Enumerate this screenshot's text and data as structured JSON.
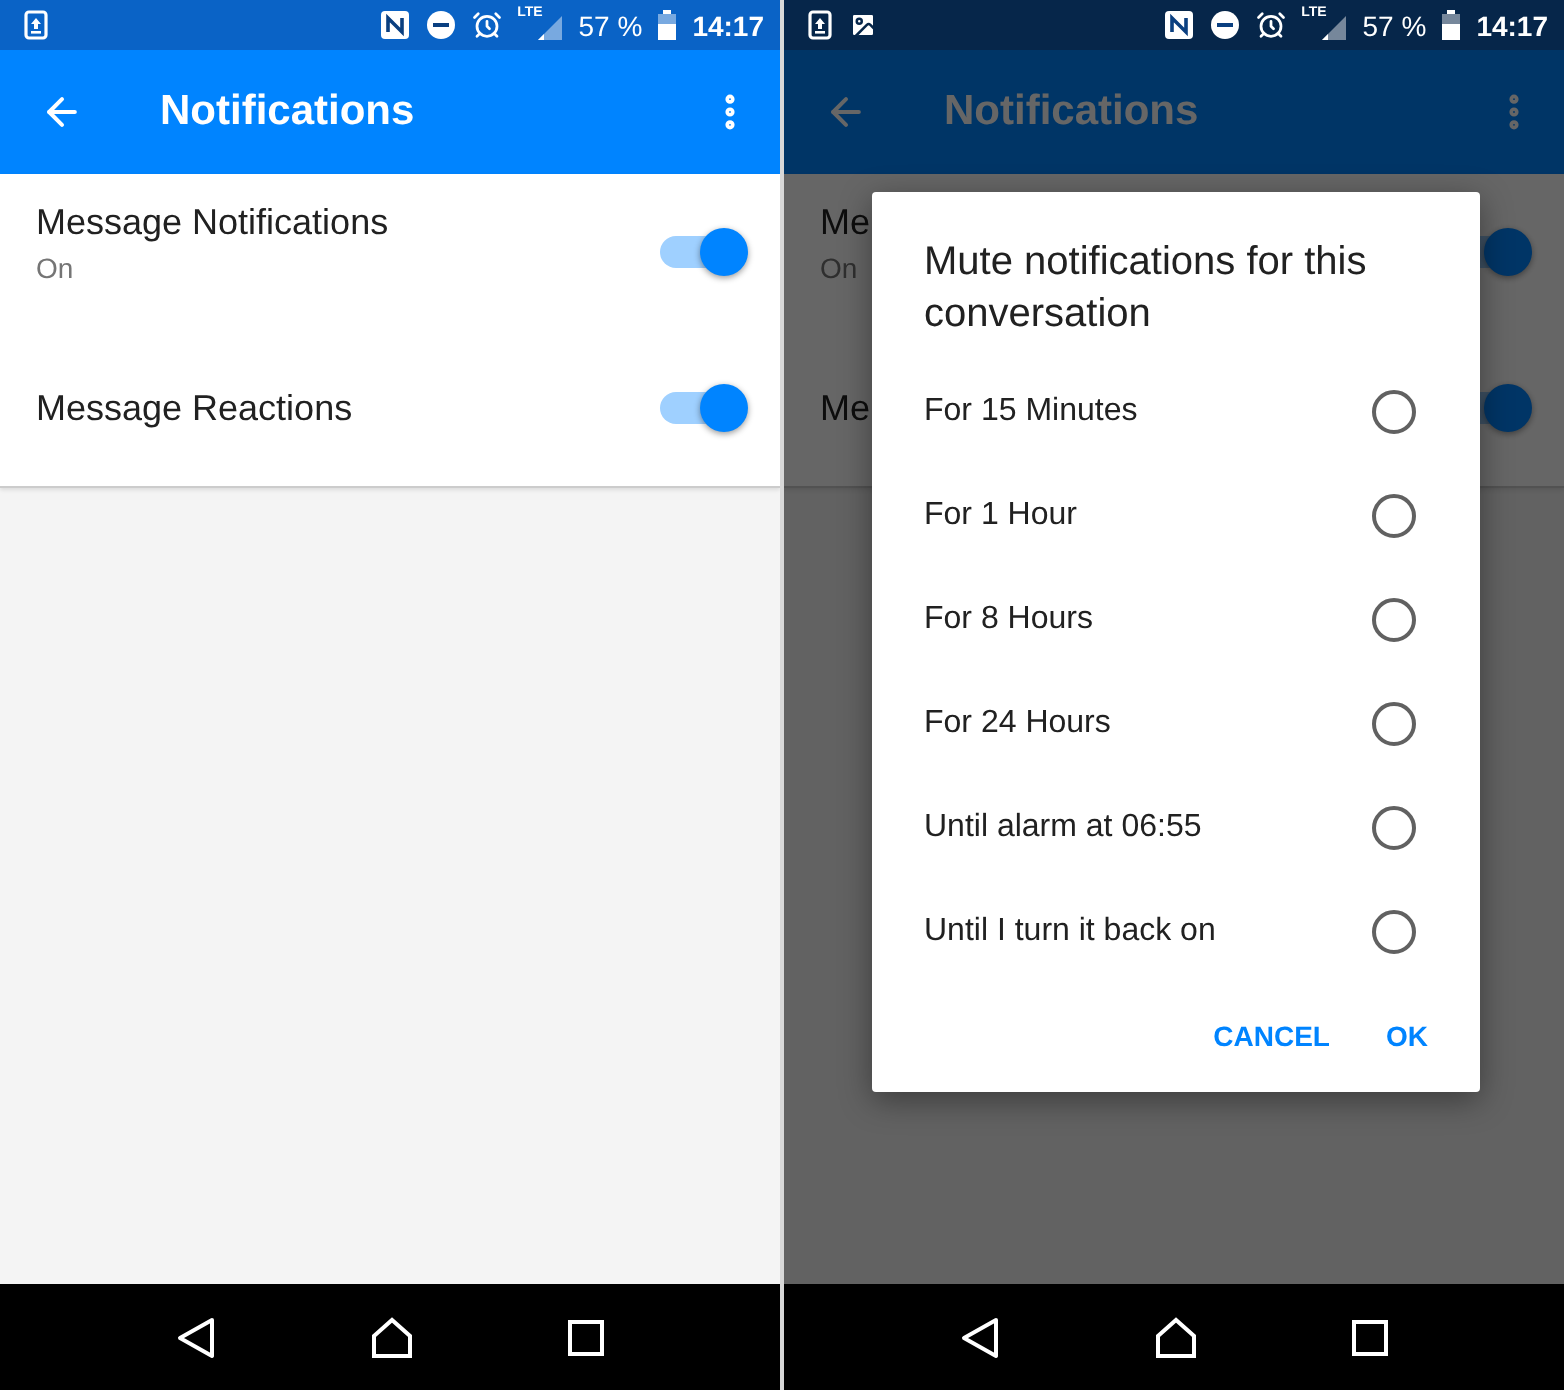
{
  "screens": [
    {
      "status_bar": {
        "notification_icons": [
          {
            "kind": "screenshot"
          }
        ],
        "network": "LTE",
        "battery": "57 %",
        "time": "14:17"
      },
      "app_bar": {
        "title": "Notifications"
      },
      "dimmed": false,
      "settings": [
        {
          "title": "Message Notifications",
          "subtitle": "On",
          "on": true
        },
        {
          "title": "Message Reactions",
          "on": true
        }
      ]
    },
    {
      "status_bar": {
        "notification_icons": [
          {
            "kind": "screenshot"
          },
          {
            "kind": "image"
          }
        ],
        "network": "LTE",
        "battery": "57 %",
        "time": "14:17"
      },
      "app_bar": {
        "title": "Notifications"
      },
      "dimmed": true,
      "settings": [
        {
          "title": "Me",
          "subtitle": "On",
          "on": true
        },
        {
          "title": "Me",
          "on": true
        }
      ],
      "dialog": {
        "title": "Mute notifications for this conversation",
        "options": [
          {
            "label": "For 15 Minutes",
            "selected": false
          },
          {
            "label": "For 1 Hour",
            "selected": false
          },
          {
            "label": "For 8 Hours",
            "selected": false
          },
          {
            "label": "For 24 Hours",
            "selected": false
          },
          {
            "label": "Until alarm at 06:55",
            "selected": false
          },
          {
            "label": "Until I turn it back on",
            "selected": false
          }
        ],
        "buttons": [
          "CANCEL",
          "OK"
        ]
      }
    }
  ]
}
